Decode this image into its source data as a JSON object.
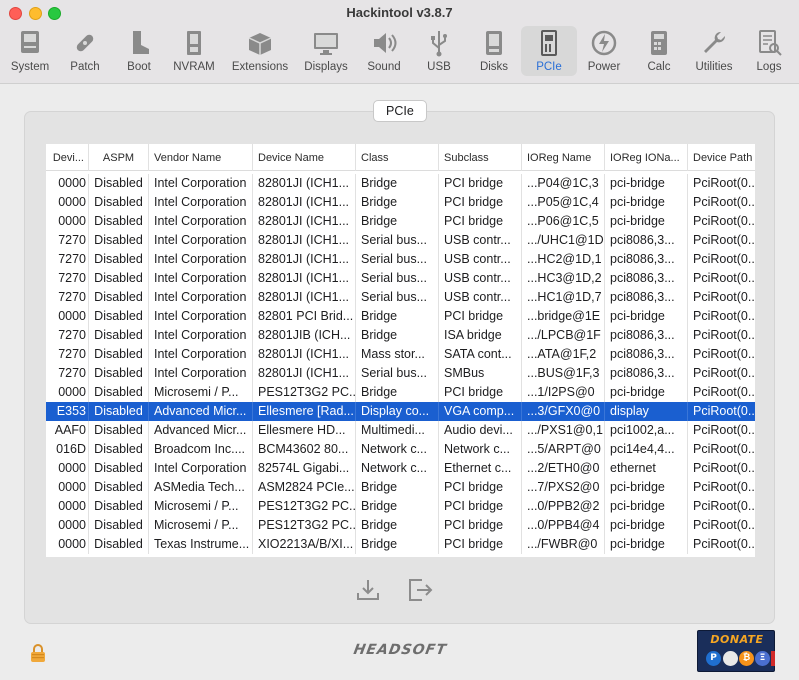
{
  "window": {
    "title": "Hackintool v3.8.7"
  },
  "toolbar": {
    "items": [
      {
        "label": "System",
        "icon": "system-icon"
      },
      {
        "label": "Patch",
        "icon": "patch-icon"
      },
      {
        "label": "Boot",
        "icon": "boot-icon"
      },
      {
        "label": "NVRAM",
        "icon": "nvram-icon"
      },
      {
        "label": "Extensions",
        "icon": "extensions-icon"
      },
      {
        "label": "Displays",
        "icon": "displays-icon"
      },
      {
        "label": "Sound",
        "icon": "sound-icon"
      },
      {
        "label": "USB",
        "icon": "usb-icon"
      },
      {
        "label": "Disks",
        "icon": "disks-icon"
      },
      {
        "label": "PCIe",
        "icon": "pcie-icon"
      },
      {
        "label": "Power",
        "icon": "power-icon"
      },
      {
        "label": "Calc",
        "icon": "calc-icon"
      },
      {
        "label": "Utilities",
        "icon": "utilities-icon"
      },
      {
        "label": "Logs",
        "icon": "logs-icon"
      }
    ],
    "active": "PCIe",
    "accent_color": "#2a6fd6"
  },
  "pane": {
    "tab_label": "PCIe"
  },
  "table": {
    "columns": [
      "Devi...",
      "ASPM",
      "Vendor Name",
      "Device Name",
      "Class",
      "Subclass",
      "IOReg Name",
      "IOReg IONa...",
      "Device Path"
    ],
    "selected_row": 12,
    "selection_color": "#1a5fd0",
    "rows": [
      [
        "0000",
        "Disabled",
        "Intel Corporation",
        "82801JI (ICH1...",
        "Bridge",
        "PCI bridge",
        "...P04@1C,3",
        "pci-bridge",
        "PciRoot(0..."
      ],
      [
        "0000",
        "Disabled",
        "Intel Corporation",
        "82801JI (ICH1...",
        "Bridge",
        "PCI bridge",
        "...P05@1C,4",
        "pci-bridge",
        "PciRoot(0..."
      ],
      [
        "0000",
        "Disabled",
        "Intel Corporation",
        "82801JI (ICH1...",
        "Bridge",
        "PCI bridge",
        "...P06@1C,5",
        "pci-bridge",
        "PciRoot(0..."
      ],
      [
        "7270",
        "Disabled",
        "Intel Corporation",
        "82801JI (ICH1...",
        "Serial bus...",
        "USB contr...",
        ".../UHC1@1D",
        "pci8086,3...",
        "PciRoot(0..."
      ],
      [
        "7270",
        "Disabled",
        "Intel Corporation",
        "82801JI (ICH1...",
        "Serial bus...",
        "USB contr...",
        "...HC2@1D,1",
        "pci8086,3...",
        "PciRoot(0..."
      ],
      [
        "7270",
        "Disabled",
        "Intel Corporation",
        "82801JI (ICH1...",
        "Serial bus...",
        "USB contr...",
        "...HC3@1D,2",
        "pci8086,3...",
        "PciRoot(0..."
      ],
      [
        "7270",
        "Disabled",
        "Intel Corporation",
        "82801JI (ICH1...",
        "Serial bus...",
        "USB contr...",
        "...HC1@1D,7",
        "pci8086,3...",
        "PciRoot(0..."
      ],
      [
        "0000",
        "Disabled",
        "Intel Corporation",
        "82801 PCI Brid...",
        "Bridge",
        "PCI bridge",
        "...bridge@1E",
        "pci-bridge",
        "PciRoot(0..."
      ],
      [
        "7270",
        "Disabled",
        "Intel Corporation",
        "82801JIB (ICH...",
        "Bridge",
        "ISA bridge",
        ".../LPCB@1F",
        "pci8086,3...",
        "PciRoot(0..."
      ],
      [
        "7270",
        "Disabled",
        "Intel Corporation",
        "82801JI (ICH1...",
        "Mass stor...",
        "SATA cont...",
        "...ATA@1F,2",
        "pci8086,3...",
        "PciRoot(0..."
      ],
      [
        "7270",
        "Disabled",
        "Intel Corporation",
        "82801JI (ICH1...",
        "Serial bus...",
        "SMBus",
        "...BUS@1F,3",
        "pci8086,3...",
        "PciRoot(0..."
      ],
      [
        "0000",
        "Disabled",
        "Microsemi / P...",
        "PES12T3G2 PC...",
        "Bridge",
        "PCI bridge",
        "...1/I2PS@0",
        "pci-bridge",
        "PciRoot(0..."
      ],
      [
        "E353",
        "Disabled",
        "Advanced Micr...",
        "Ellesmere [Rad...",
        "Display co...",
        "VGA comp...",
        "...3/GFX0@0",
        "display",
        "PciRoot(0..."
      ],
      [
        "AAF0",
        "Disabled",
        "Advanced Micr...",
        "Ellesmere HD...",
        "Multimedi...",
        "Audio devi...",
        ".../PXS1@0,1",
        "pci1002,a...",
        "PciRoot(0..."
      ],
      [
        "016D",
        "Disabled",
        "Broadcom Inc....",
        "BCM43602 80...",
        "Network c...",
        "Network c...",
        "...5/ARPT@0",
        "pci14e4,4...",
        "PciRoot(0..."
      ],
      [
        "0000",
        "Disabled",
        "Intel Corporation",
        "82574L Gigabi...",
        "Network c...",
        "Ethernet c...",
        "...2/ETH0@0",
        "ethernet",
        "PciRoot(0..."
      ],
      [
        "0000",
        "Disabled",
        "ASMedia Tech...",
        "ASM2824 PCIe...",
        "Bridge",
        "PCI bridge",
        "...7/PXS2@0",
        "pci-bridge",
        "PciRoot(0..."
      ],
      [
        "0000",
        "Disabled",
        "Microsemi / P...",
        "PES12T3G2 PC...",
        "Bridge",
        "PCI bridge",
        "...0/PPB2@2",
        "pci-bridge",
        "PciRoot(0..."
      ],
      [
        "0000",
        "Disabled",
        "Microsemi / P...",
        "PES12T3G2 PC...",
        "Bridge",
        "PCI bridge",
        "...0/PPB4@4",
        "pci-bridge",
        "PciRoot(0..."
      ],
      [
        "0000",
        "Disabled",
        "Texas Instrume...",
        "XIO2213A/B/XI...",
        "Bridge",
        "PCI bridge",
        ".../FWBR@0",
        "pci-bridge",
        "PciRoot(0..."
      ]
    ]
  },
  "footer": {
    "brand": "HEADSOFT",
    "donate_label": "DONATE",
    "donate_coins": [
      "P",
      "₿",
      "Ξ",
      "/"
    ]
  }
}
